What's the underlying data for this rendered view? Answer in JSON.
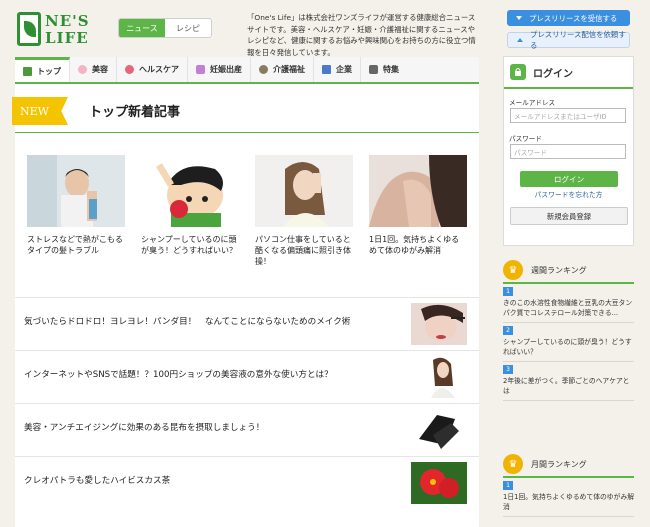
{
  "header": {
    "logo_text": "NE'S LIFE",
    "toggle": {
      "news": "ニュース",
      "recipe": "レシピ"
    },
    "description": "「One's Life」は株式会社ワンズライフが運営する健康総合ニュースサイトです。美容・ヘルスケア・妊娠・介護福祉に関するニュースやレシピなど、健康に関するお悩みや興味関心をお持ちの方に役立つ情報を日々発信しています。"
  },
  "nav": [
    {
      "label": "トップ",
      "icon": "home-icon",
      "color": "#4a9a3a"
    },
    {
      "label": "美容",
      "icon": "beauty-icon",
      "color": "#f08ca8"
    },
    {
      "label": "ヘルスケア",
      "icon": "heart-icon",
      "color": "#e8657a"
    },
    {
      "label": "妊娠出産",
      "icon": "bottle-icon",
      "color": "#c27fd6"
    },
    {
      "label": "介護福祉",
      "icon": "person-icon",
      "color": "#8a7a60"
    },
    {
      "label": "企業",
      "icon": "building-icon",
      "color": "#4a7ac8"
    },
    {
      "label": "特集",
      "icon": "camera-icon",
      "color": "#666666"
    }
  ],
  "section": {
    "badge": "NEW",
    "title": "トップ新着記事"
  },
  "cards": [
    {
      "title": "ストレスなどで熱がこもるタイプの髪トラブル"
    },
    {
      "title": "シャンプーしているのに頭が臭う！どうすればいい？"
    },
    {
      "title": "パソコン仕事をしていると酷くなる偏頭痛に照引き体操！"
    },
    {
      "title": "1日1回。気持ちよくゆるめて体のゆがみ解消"
    }
  ],
  "list": [
    {
      "title": "気づいたらドロドロ！ヨレヨレ！パンダ目！　なんてことにならないためのメイク術"
    },
    {
      "title": "インターネットやSNSで話題！？100円ショップの美容液の意外な使い方とは？"
    },
    {
      "title": "美容・アンチエイジングに効果のある昆布を摂取しましょう！"
    },
    {
      "title": "クレオパトラも愛したハイビスカス茶"
    }
  ],
  "sidebar": {
    "press_receive": "プレスリリースを受信する",
    "press_request": "プレスリリース配信を依頼する",
    "login": {
      "title": "ログイン",
      "email_label": "メールアドレス",
      "email_placeholder": "メールアドレスまたはユーザID",
      "password_label": "パスワード",
      "password_placeholder": "パスワード",
      "login_button": "ログイン",
      "forgot": "パスワードを忘れた方",
      "register": "新規会員登録"
    },
    "weekly": {
      "title": "週間ランキング",
      "items": [
        {
          "num": "1",
          "text": "きのこの水溶性食物繊維と豆乳の大豆タンパク質でコレステロール対策できる..."
        },
        {
          "num": "2",
          "text": "シャンプーしているのに頭が臭う！どうすればいい？"
        },
        {
          "num": "3",
          "text": "2年後に差がつく。季節ごとのヘアケアとは"
        }
      ]
    },
    "monthly": {
      "title": "月間ランキング",
      "items": [
        {
          "num": "1",
          "text": "1日1回。気持ちよくゆるめて体のゆがみ解消"
        }
      ]
    }
  },
  "colors": {
    "accent": "#5cb546",
    "brand": "#2f8f35",
    "badge": "#f4c400",
    "link": "#3b8fe0"
  }
}
